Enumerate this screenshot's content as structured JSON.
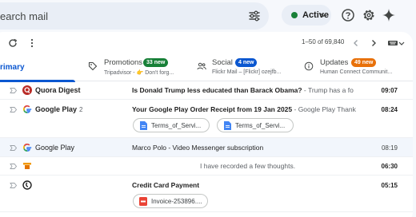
{
  "search": {
    "text": "earch mail"
  },
  "status": {
    "label": "Active",
    "color": "#188038"
  },
  "toolbar": {
    "page_info": "1–50 of 69,840"
  },
  "tabs": [
    {
      "label": "rimary"
    },
    {
      "label": "Promotions",
      "badge": "33 new",
      "badge_color": "#188038",
      "sub": "Tripadvisor - 👉 Don't forg..."
    },
    {
      "label": "Social",
      "badge": "4 new",
      "badge_color": "#0b57d0",
      "sub": "Flickr Mail – [Flickr] ozejfb..."
    },
    {
      "label": "Updates",
      "badge": "49 new",
      "badge_color": "#e8710a",
      "sub": "Human Connect Communit..."
    }
  ],
  "emails": [
    {
      "sender": "Quora Digest",
      "count": "",
      "unread": true,
      "subject": "Is Donald Trump less educated than Barack Obama?",
      "snippet": " - Trump has a fo",
      "time": "09:07",
      "attachments": []
    },
    {
      "sender": "Google Play",
      "count": "2",
      "unread": true,
      "subject": "Your Google Play Order Receipt from 19 Jan 2025",
      "snippet": " - Google Play Thank",
      "time": "08:24",
      "attachments": [
        {
          "name": "Terms_of_Servi..."
        },
        {
          "name": "Terms_of_Servi..."
        }
      ]
    },
    {
      "sender": "Google Play",
      "count": "",
      "unread": false,
      "subject": "Marco Polo - Video Messenger subscription",
      "snippet": "",
      "time": "08:19",
      "attachments": []
    },
    {
      "sender": "",
      "count": "",
      "unread": true,
      "subject": "",
      "snippet": "I have recorded a few thoughts.",
      "time": "06:30",
      "attachments": []
    },
    {
      "sender": "",
      "count": "",
      "unread": true,
      "subject": "Credit Card Payment",
      "snippet": "",
      "time": "05:15",
      "attachments": [
        {
          "name": "Invoice-253896...."
        }
      ]
    }
  ]
}
